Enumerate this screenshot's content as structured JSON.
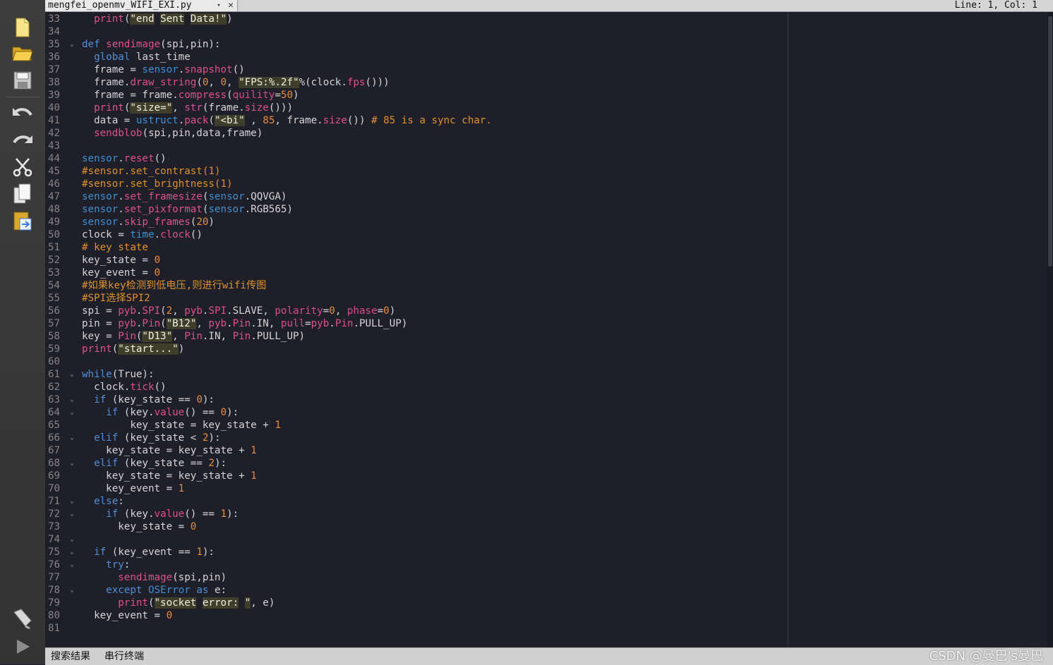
{
  "tabbar": {
    "file_name": "mengfei_openmv_WIFI_EXI.py",
    "dropdown": "▾",
    "close": "✕",
    "cursor_position": "Line: 1, Col: 1"
  },
  "toolbar": {
    "icons": [
      "new-file-icon",
      "open-folder-icon",
      "save-icon",
      "undo-icon",
      "redo-icon",
      "cut-icon",
      "copy-icon",
      "paste-icon",
      "connect-icon",
      "run-icon"
    ]
  },
  "editor": {
    "lines": [
      {
        "n": "33",
        "fold": "",
        "html": "  <span class=\"fn\">print</span>(<span class=\"str\">\"end</span> <span class=\"str\">Sent</span> <span class=\"str\">Data!\"</span>)"
      },
      {
        "n": "34",
        "fold": "",
        "html": ""
      },
      {
        "n": "35",
        "fold": "⌄",
        "html": "<span class=\"kw\">def</span> <span class=\"fn\">sendimage</span>(spi,pin):"
      },
      {
        "n": "36",
        "fold": "",
        "html": "  <span class=\"kw\">global</span> last_time"
      },
      {
        "n": "37",
        "fold": "",
        "html": "  frame = <span class=\"mod\">sensor</span>.<span class=\"fn\">snapshot</span>()"
      },
      {
        "n": "38",
        "fold": "",
        "html": "  frame.<span class=\"fn\">draw_string</span>(<span class=\"num\">0</span>, <span class=\"num\">0</span>, <span class=\"str\">\"FPS:%.2f\"</span>%(clock.<span class=\"fn\">fps</span>()))"
      },
      {
        "n": "39",
        "fold": "",
        "html": "  frame = frame.<span class=\"fn\">compress</span>(<span class=\"kwarg\">quility</span>=<span class=\"num\">50</span>)"
      },
      {
        "n": "40",
        "fold": "",
        "html": "  <span class=\"fn\">print</span>(<span class=\"str\">\"size=\"</span>, <span class=\"bi\">str</span>(frame.<span class=\"fn\">size</span>()))"
      },
      {
        "n": "41",
        "fold": "",
        "html": "  data = <span class=\"mod\">ustruct</span>.<span class=\"fn\">pack</span>(<span class=\"str\">\"&lt;bi\"</span> , <span class=\"num\">85</span>, frame.<span class=\"fn\">size</span>()) <span class=\"cm\"># 85 is a sync char.</span>"
      },
      {
        "n": "42",
        "fold": "",
        "html": "  <span class=\"fn\">sendblob</span>(spi,pin,data,frame)"
      },
      {
        "n": "43",
        "fold": "",
        "html": ""
      },
      {
        "n": "44",
        "fold": "",
        "html": "<span class=\"mod\">sensor</span>.<span class=\"fn\">reset</span>()"
      },
      {
        "n": "45",
        "fold": "",
        "html": "<span class=\"cm\">#sensor.set_contrast(1)</span>"
      },
      {
        "n": "46",
        "fold": "",
        "html": "<span class=\"cm\">#sensor.set_brightness(1)</span>"
      },
      {
        "n": "47",
        "fold": "",
        "html": "<span class=\"mod\">sensor</span>.<span class=\"fn\">set_framesize</span>(<span class=\"mod\">sensor</span>.QQVGA)"
      },
      {
        "n": "48",
        "fold": "",
        "html": "<span class=\"mod\">sensor</span>.<span class=\"fn\">set_pixformat</span>(<span class=\"mod\">sensor</span>.RGB565)"
      },
      {
        "n": "49",
        "fold": "",
        "html": "<span class=\"mod\">sensor</span>.<span class=\"fn\">skip_frames</span>(<span class=\"num\">20</span>)"
      },
      {
        "n": "50",
        "fold": "",
        "html": "clock = <span class=\"mod\">time</span>.<span class=\"fn\">clock</span>()"
      },
      {
        "n": "51",
        "fold": "",
        "html": "<span class=\"cm\"># key state</span>"
      },
      {
        "n": "52",
        "fold": "",
        "html": "key_state = <span class=\"num\">0</span>"
      },
      {
        "n": "53",
        "fold": "",
        "html": "key_event = <span class=\"num\">0</span>"
      },
      {
        "n": "54",
        "fold": "",
        "html": "<span class=\"cm\">#如果key检测到低电压,则进行wifi传图</span>"
      },
      {
        "n": "55",
        "fold": "",
        "html": "<span class=\"cm\">#SPI选择SPI2</span>"
      },
      {
        "n": "56",
        "fold": "",
        "html": "spi = <span class=\"fn\">pyb</span>.<span class=\"fn\">SPI</span>(<span class=\"num\">2</span>, <span class=\"fn\">pyb</span>.<span class=\"fn\">SPI</span>.SLAVE, <span class=\"kwarg\">polarity</span>=<span class=\"num\">0</span>, <span class=\"kwarg\">phase</span>=<span class=\"num\">0</span>)"
      },
      {
        "n": "57",
        "fold": "",
        "html": "pin = <span class=\"fn\">pyb</span>.<span class=\"fn\">Pin</span>(<span class=\"str\">\"B12\"</span>, <span class=\"fn\">pyb</span>.<span class=\"fn\">Pin</span>.IN, <span class=\"kwarg\">pull</span>=<span class=\"fn\">pyb</span>.<span class=\"fn\">Pin</span>.PULL_UP)"
      },
      {
        "n": "58",
        "fold": "",
        "html": "key = <span class=\"fn\">Pin</span>(<span class=\"str\">\"D13\"</span>, <span class=\"fn\">Pin</span>.IN, <span class=\"fn\">Pin</span>.PULL_UP)"
      },
      {
        "n": "59",
        "fold": "",
        "html": "<span class=\"fn\">print</span>(<span class=\"str\">\"start...\"</span>)"
      },
      {
        "n": "60",
        "fold": "",
        "html": ""
      },
      {
        "n": "61",
        "fold": "⌄",
        "html": "<span class=\"kw\">while</span>(True):"
      },
      {
        "n": "62",
        "fold": "",
        "html": "  clock.<span class=\"fn\">tick</span>()"
      },
      {
        "n": "63",
        "fold": "⌄",
        "html": "  <span class=\"kw\">if</span> (key_state == <span class=\"num\">0</span>):"
      },
      {
        "n": "64",
        "fold": "⌄",
        "html": "    <span class=\"kw\">if</span> (key.<span class=\"fn\">value</span>() == <span class=\"num\">0</span>):"
      },
      {
        "n": "65",
        "fold": "",
        "html": "        key_state = key_state + <span class=\"num\">1</span>"
      },
      {
        "n": "66",
        "fold": "⌄",
        "html": "  <span class=\"kw\">elif</span> (key_state &lt; <span class=\"num\">2</span>):"
      },
      {
        "n": "67",
        "fold": "",
        "html": "    key_state = key_state + <span class=\"num\">1</span>"
      },
      {
        "n": "68",
        "fold": "⌄",
        "html": "  <span class=\"kw\">elif</span> (key_state == <span class=\"num\">2</span>):"
      },
      {
        "n": "69",
        "fold": "",
        "html": "    key_state = key_state + <span class=\"num\">1</span>"
      },
      {
        "n": "70",
        "fold": "",
        "html": "    key_event = <span class=\"num\">1</span>"
      },
      {
        "n": "71",
        "fold": "⌄",
        "html": "  <span class=\"kw\">else</span>:"
      },
      {
        "n": "72",
        "fold": "⌄",
        "html": "    <span class=\"kw\">if</span> (key.<span class=\"fn\">value</span>() == <span class=\"num\">1</span>):"
      },
      {
        "n": "73",
        "fold": "",
        "html": "      key_state = <span class=\"num\">0</span>"
      },
      {
        "n": "74",
        "fold": "⌄",
        "html": ""
      },
      {
        "n": "75",
        "fold": "⌄",
        "html": "  <span class=\"kw\">if</span> (key_event == <span class=\"num\">1</span>):"
      },
      {
        "n": "76",
        "fold": "⌄",
        "html": "    <span class=\"kw\">try</span>:"
      },
      {
        "n": "77",
        "fold": "",
        "html": "      <span class=\"fn\">sendimage</span>(spi,pin)"
      },
      {
        "n": "78",
        "fold": "⌄",
        "html": "    <span class=\"kw\">except</span> <span class=\"mod\">OSError</span> <span class=\"kw\">as</span> e:"
      },
      {
        "n": "79",
        "fold": "",
        "html": "      <span class=\"fn\">print</span>(<span class=\"str\">\"socket</span> <span class=\"str\">error:</span> <span class=\"str\">\"</span>, e)"
      },
      {
        "n": "80",
        "fold": "",
        "html": "  key_event = <span class=\"num\">0</span>"
      },
      {
        "n": "81",
        "fold": "",
        "html": ""
      }
    ]
  },
  "bottombar": {
    "tabs": [
      "搜索结果",
      "串行终端"
    ],
    "watermark": "CSDN @曼巴's曼巴"
  }
}
